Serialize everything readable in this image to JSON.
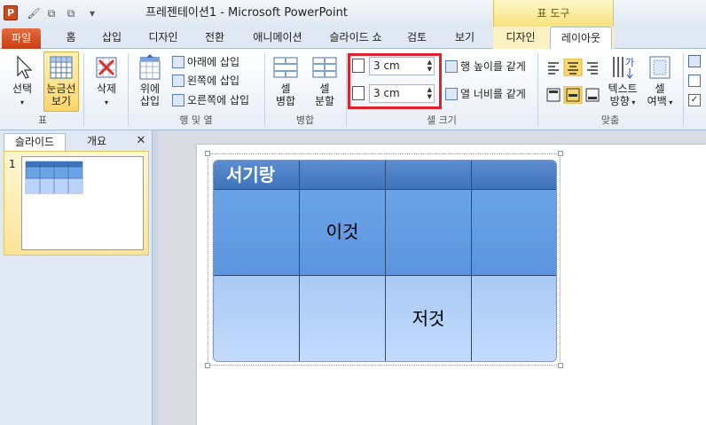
{
  "window": {
    "title": "프레젠테이션1 - Microsoft PowerPoint",
    "app_icon_letter": "P",
    "context_group": "표 도구"
  },
  "tabs": {
    "file": "파일",
    "home": "홈",
    "insert": "삽입",
    "design": "디자인",
    "transitions": "전환",
    "animations": "애니메이션",
    "slideshow": "슬라이드 쇼",
    "review": "검토",
    "view": "보기",
    "table_design": "디자인",
    "table_layout": "레이아웃"
  },
  "ribbon": {
    "table_group": {
      "label": "표",
      "select_line1": "선택",
      "gridlines_line1": "눈금선",
      "gridlines_line2": "보기"
    },
    "rows_cols_group": {
      "label": "행 및 열",
      "delete": "삭제",
      "insert_above_line1": "위에",
      "insert_above_line2": "삽입",
      "insert_below": "아래에 삽입",
      "insert_left": "왼쪽에 삽입",
      "insert_right": "오른쪽에 삽입"
    },
    "merge_group": {
      "label": "병합",
      "merge_line1": "셀",
      "merge_line2": "병합",
      "split_line1": "셀",
      "split_line2": "분할"
    },
    "cell_size_group": {
      "label": "셀 크기",
      "height_value": "3 cm",
      "width_value": "3 cm",
      "distribute_rows": "행 높이를 같게",
      "distribute_cols": "열 너비를 같게"
    },
    "alignment_group": {
      "label": "맞춤",
      "text_dir_line1": "텍스트",
      "text_dir_line2": "방향",
      "margins_line1": "셀",
      "margins_line2": "여백"
    },
    "highlight_color": "#e0202b"
  },
  "pane": {
    "tab_slides": "슬라이드",
    "tab_outline": "개요",
    "close": "✕",
    "slide_number": "1"
  },
  "slide_table": {
    "header": [
      "서기랑",
      "",
      "",
      ""
    ],
    "rows": [
      [
        "",
        "이것",
        "",
        ""
      ],
      [
        "",
        "",
        "저것",
        ""
      ]
    ]
  }
}
